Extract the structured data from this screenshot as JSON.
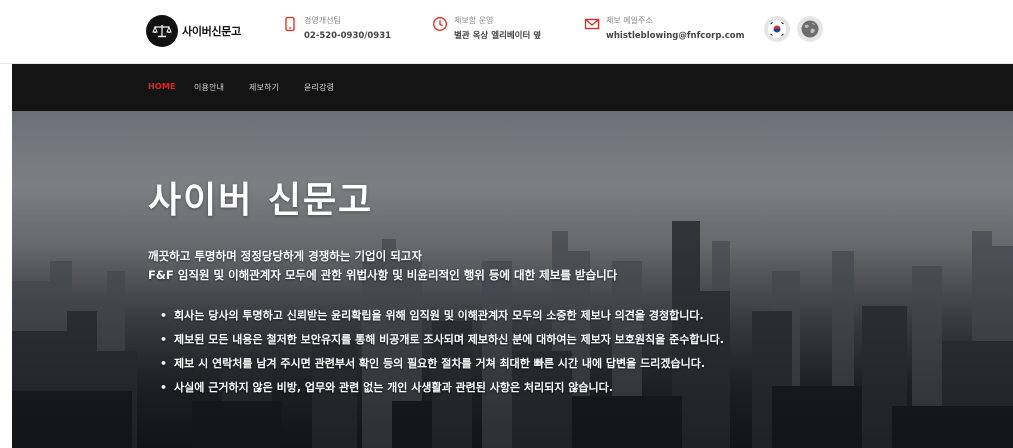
{
  "brand": {
    "name": "사이버신문고"
  },
  "contact": {
    "phone": {
      "label": "경영개선팀",
      "value": "02-520-0930/0931",
      "icon": "phone-icon"
    },
    "hours": {
      "label": "제보함 운영",
      "value": "별관 옥상 엘리베이터 옆",
      "icon": "clock-icon"
    },
    "email": {
      "label": "제보 메일주소",
      "value": "whistleblowing@fnfcorp.com",
      "icon": "mail-icon"
    }
  },
  "languages": [
    {
      "name": "korean-flag-icon"
    },
    {
      "name": "globe-icon"
    }
  ],
  "nav": {
    "items": [
      {
        "label": "HOME",
        "active": true
      },
      {
        "label": "이용안내"
      },
      {
        "label": "제보하기"
      },
      {
        "label": "윤리강령"
      }
    ]
  },
  "hero": {
    "title": "사이버 신문고",
    "subtitle_1": "깨끗하고 투명하며 정정당당하게 경쟁하는 기업이 되고자",
    "subtitle_2": "F&F 임직원 및 이해관계자 모두에 관한 위법사항 및 비윤리적인 행위 등에 대한 제보를 받습니다",
    "bullets": [
      "회사는 당사의 투명하고 신뢰받는 윤리확립을 위해 임직원 및 이해관계자 모두의 소중한 제보나 의견을 경청합니다.",
      "제보된 모든 내용은 철저한 보안유지를 통해 비공개로 조사되며 제보하신 분에 대하여는 제보자 보호원칙을 준수합니다.",
      "제보 시 연락처를 남겨 주시면 관련부서 확인 등의 필요한 절차를 거쳐 최대한 빠른 시간 내에 답변을 드리겠습니다.",
      "사실에 근거하지 않은 비방, 업무와 관련 없는 개인 사생활과 관련된 사항은 처리되지 않습니다."
    ]
  },
  "colors": {
    "accent": "#e2261f",
    "nav_bg": "#141414",
    "icon_red": "#e2261f"
  }
}
